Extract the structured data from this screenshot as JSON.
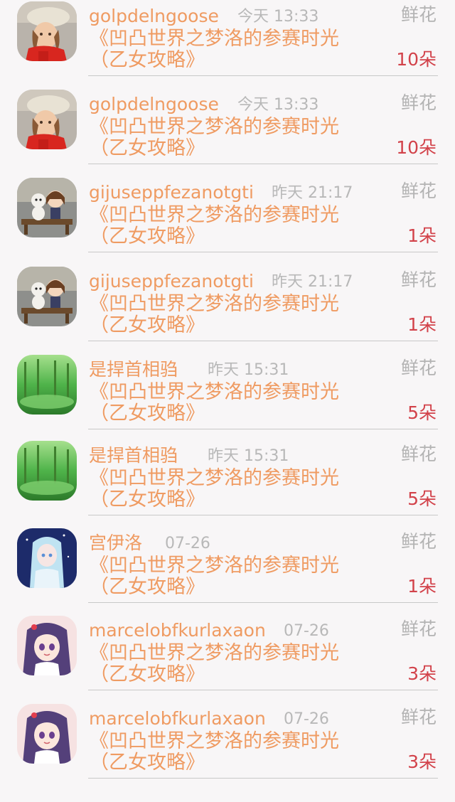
{
  "items": [
    {
      "username": "golpdelngoose",
      "time": "今天 13:33",
      "gift_type": "鲜花",
      "title": "《凹凸世界之梦洛的参赛时光（乙女攻略》",
      "count": "10朵",
      "avatar": "girl-beret"
    },
    {
      "username": "golpdelngoose",
      "time": "今天 13:33",
      "gift_type": "鲜花",
      "title": "《凹凸世界之梦洛的参赛时光（乙女攻略》",
      "count": "10朵",
      "avatar": "girl-beret"
    },
    {
      "username": "gijuseppfezanotgti",
      "time": "昨天 21:17",
      "gift_type": "鲜花",
      "title": "《凹凸世界之梦洛的参赛时光（乙女攻略》",
      "count": "1朵",
      "avatar": "figurines"
    },
    {
      "username": "gijuseppfezanotgti",
      "time": "昨天 21:17",
      "gift_type": "鲜花",
      "title": "《凹凸世界之梦洛的参赛时光（乙女攻略》",
      "count": "1朵",
      "avatar": "figurines"
    },
    {
      "username": "是捍首相驺",
      "time": "昨天 15:31",
      "gift_type": "鲜花",
      "title": "《凹凸世界之梦洛的参赛时光（乙女攻略》",
      "count": "5朵",
      "avatar": "forest"
    },
    {
      "username": "是捍首相驺",
      "time": "昨天 15:31",
      "gift_type": "鲜花",
      "title": "《凹凸世界之梦洛的参赛时光（乙女攻略》",
      "count": "5朵",
      "avatar": "forest"
    },
    {
      "username": "宫伊洛",
      "time": "07-26",
      "gift_type": "鲜花",
      "title": "《凹凸世界之梦洛的参赛时光（乙女攻略》",
      "count": "1朵",
      "avatar": "anime-blue"
    },
    {
      "username": "marcelobfkurlaxaon",
      "time": "07-26",
      "gift_type": "鲜花",
      "title": "《凹凸世界之梦洛的参赛时光（乙女攻略》",
      "count": "3朵",
      "avatar": "anime-purple"
    },
    {
      "username": "marcelobfkurlaxaon",
      "time": "07-26",
      "gift_type": "鲜花",
      "title": "《凹凸世界之梦洛的参赛时光（乙女攻略》",
      "count": "3朵",
      "avatar": "anime-purple"
    }
  ],
  "colors": {
    "background": "#f8f6f7",
    "username": "#ef9b62",
    "time": "#b8b8b8",
    "gift_type": "#b3b3b3",
    "count": "#d2424a",
    "divider": "#c8c8c8"
  }
}
